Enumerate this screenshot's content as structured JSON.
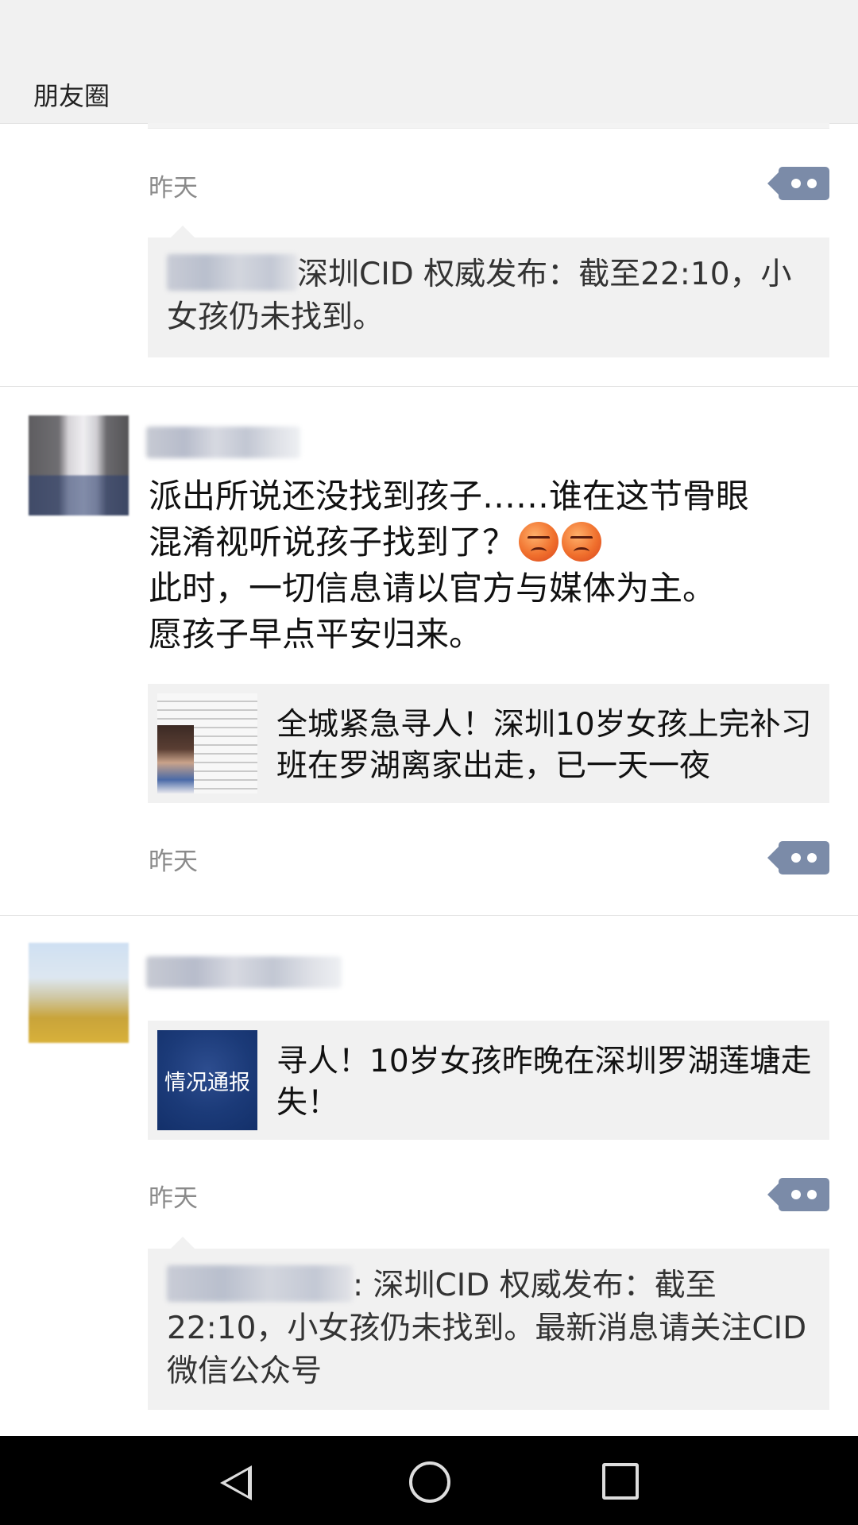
{
  "header": {
    "title": "朋友圈"
  },
  "posts": [
    {
      "time": "昨天",
      "comment": {
        "text": "深圳CID 权威发布：截至22:10，小女孩仍未找到。"
      }
    },
    {
      "text_lines": [
        "派出所说还没找到孩子……谁在这节骨眼",
        "混淆视听说孩子找到了？",
        "此时，一切信息请以官方与媒体为主。",
        "愿孩子早点平安归来。"
      ],
      "emojis": [
        "angry-face",
        "angry-face"
      ],
      "link": {
        "title": "全城紧急寻人！深圳10岁女孩上完补习班在罗湖离家出走，已一天一夜"
      },
      "time": "昨天"
    },
    {
      "link": {
        "title": "寻人！10岁女孩昨晚在深圳罗湖莲塘走失！",
        "thumb_text": "情况通报"
      },
      "time": "昨天",
      "comment": {
        "text": ": 深圳CID 权威发布：截至22:10，小女孩仍未找到。最新消息请关注CID微信公众号"
      }
    }
  ],
  "navbar": {
    "icons": [
      "back-icon",
      "home-icon",
      "recent-apps-icon"
    ]
  }
}
